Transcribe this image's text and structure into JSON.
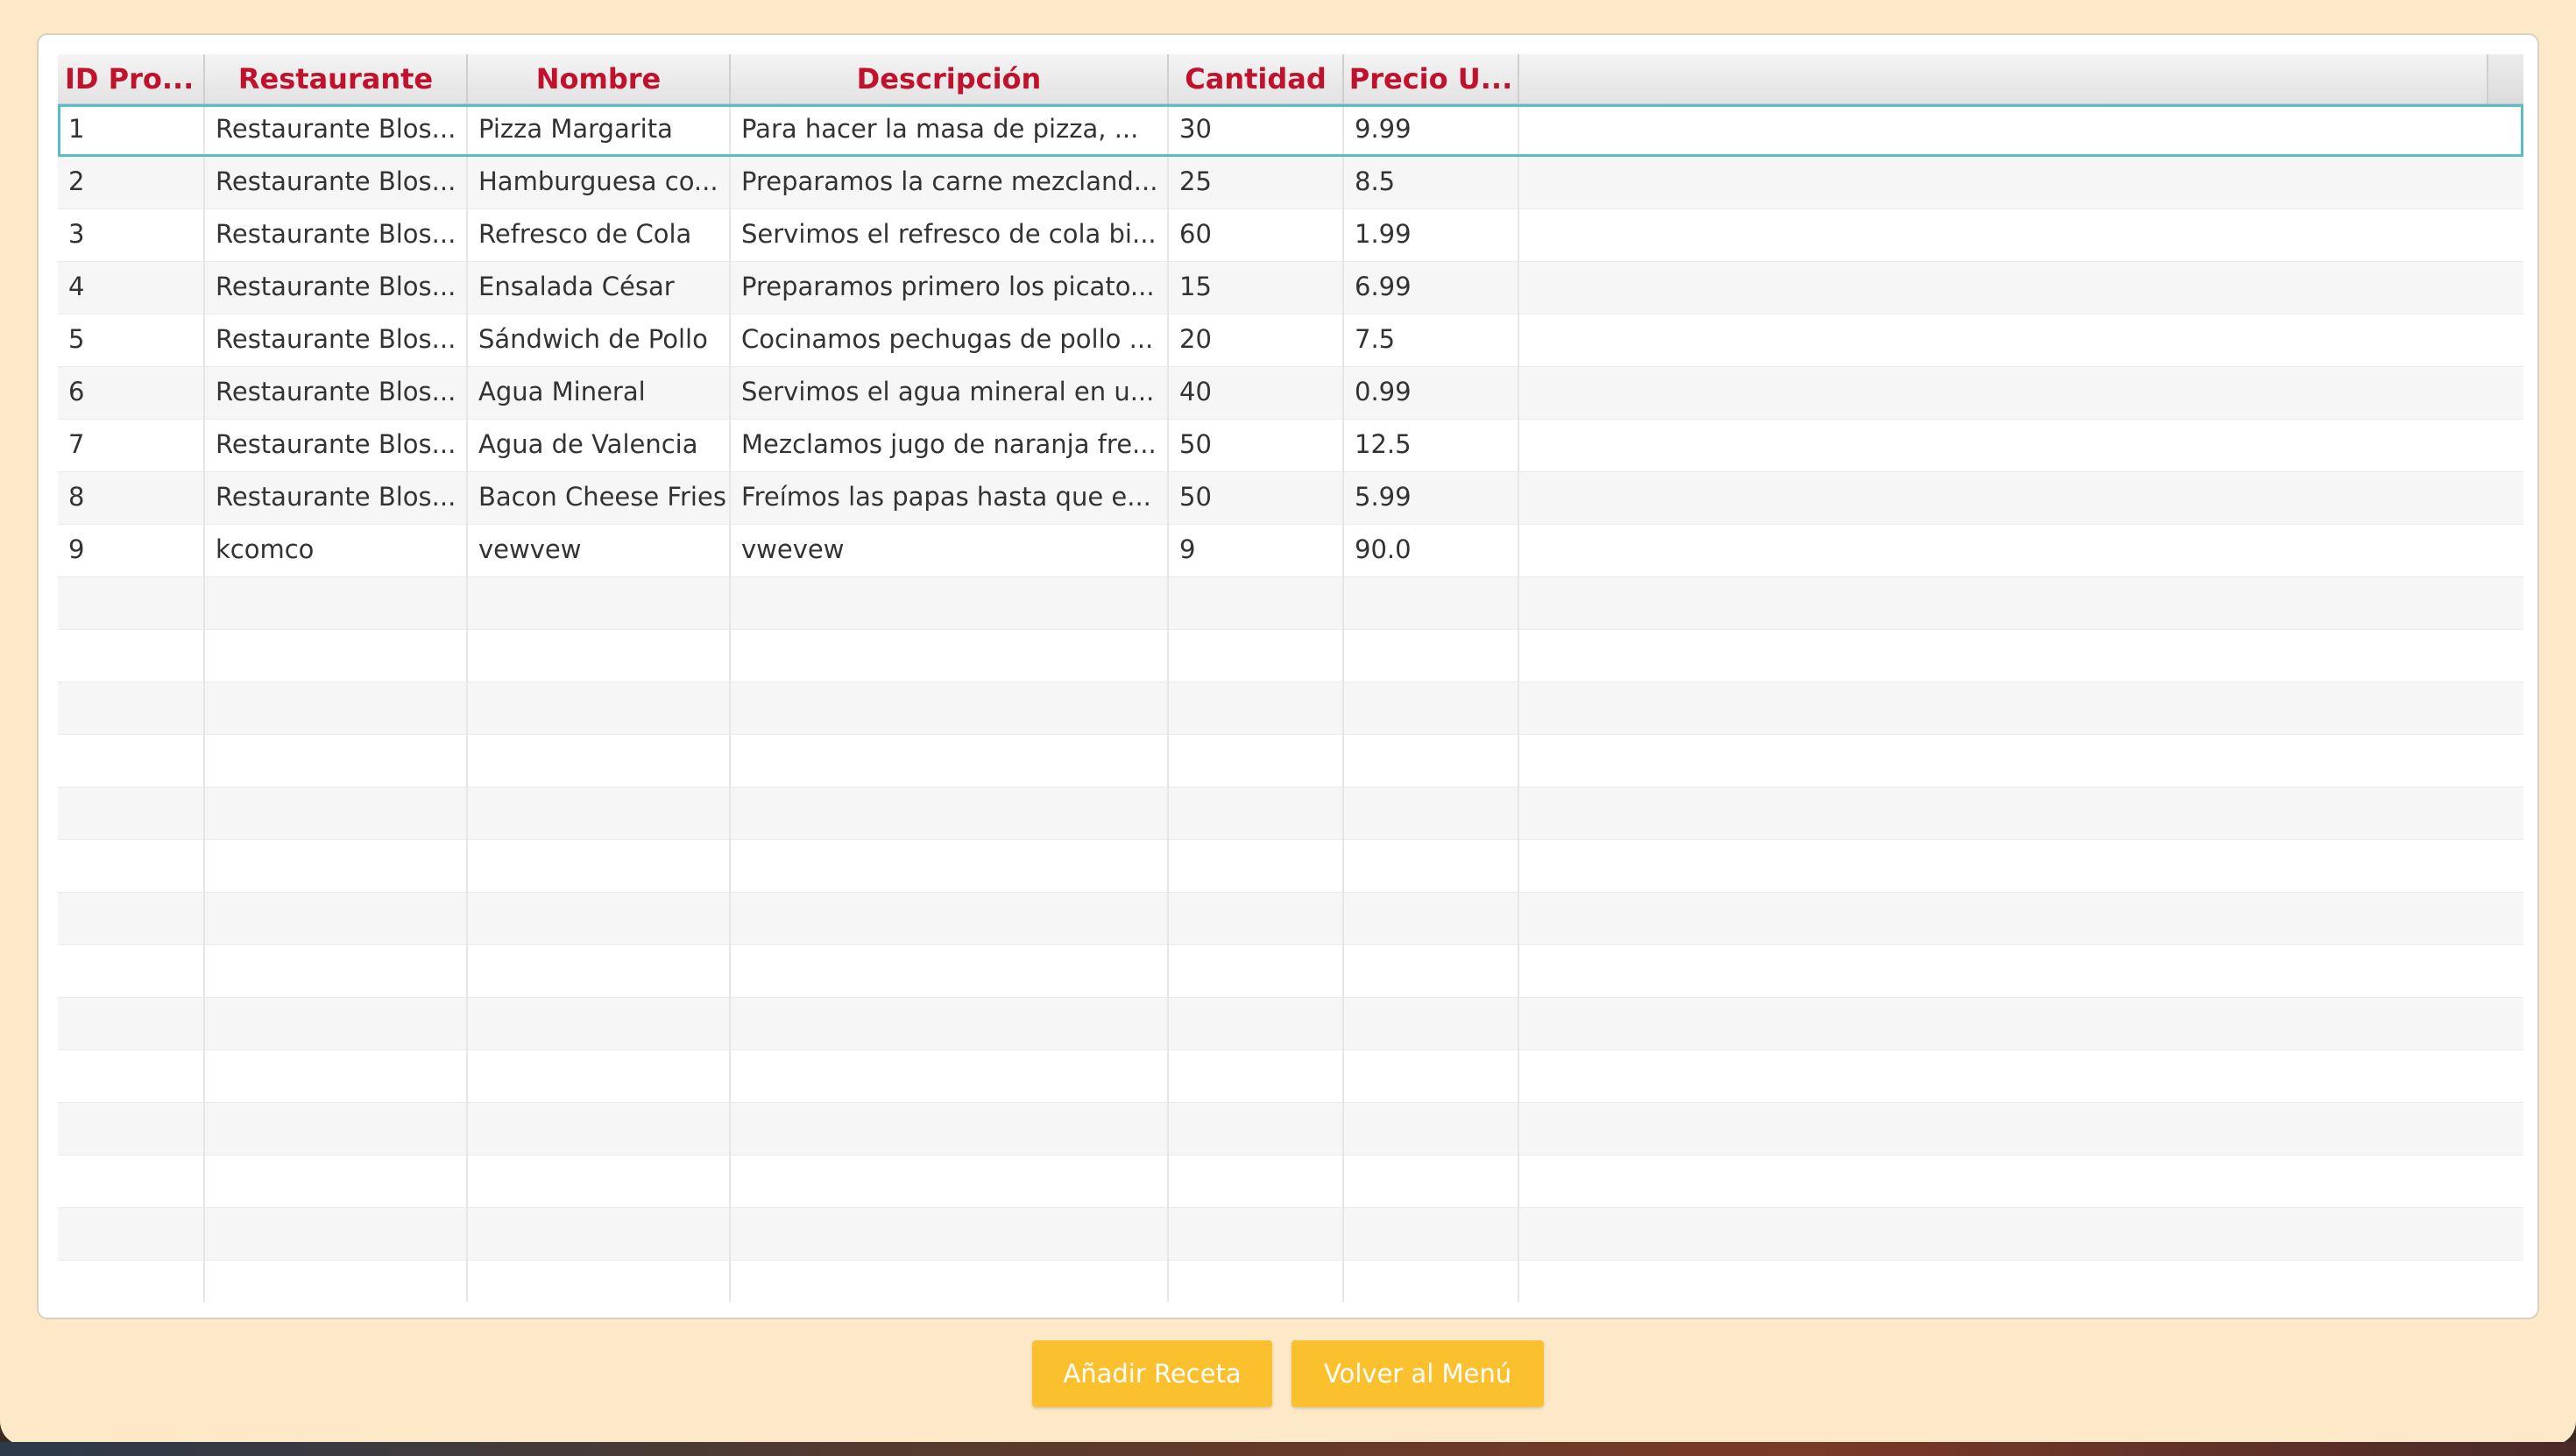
{
  "table": {
    "columns": [
      "ID Pro...",
      "Restaurante",
      "Nombre",
      "Descripción",
      "Cantidad",
      "Precio U..."
    ],
    "rows": [
      [
        "1",
        "Restaurante Blos...",
        "Pizza Margarita",
        "Para hacer la masa de pizza, ...",
        "30",
        "9.99"
      ],
      [
        "2",
        "Restaurante Blos...",
        "Hamburguesa co...",
        "Preparamos la carne mezcland...",
        "25",
        "8.5"
      ],
      [
        "3",
        "Restaurante Blos...",
        "Refresco de Cola",
        "Servimos el refresco de cola bi...",
        "60",
        "1.99"
      ],
      [
        "4",
        "Restaurante Blos...",
        "Ensalada César",
        "Preparamos primero los picato...",
        "15",
        "6.99"
      ],
      [
        "5",
        "Restaurante Blos...",
        "Sándwich de Pollo",
        "Cocinamos pechugas de pollo ...",
        "20",
        "7.5"
      ],
      [
        "6",
        "Restaurante Blos...",
        "Agua Mineral",
        "Servimos el agua mineral en u...",
        "40",
        "0.99"
      ],
      [
        "7",
        "Restaurante Blos...",
        "Agua de Valencia",
        "Mezclamos jugo de naranja fre...",
        "50",
        "12.5"
      ],
      [
        "8",
        "Restaurante Blos...",
        "Bacon Cheese Fries",
        "Freímos las papas hasta que e...",
        "50",
        "5.99"
      ],
      [
        "9",
        "kcomco",
        "vewvew",
        "vwevew",
        "9",
        "90.0"
      ]
    ],
    "selected_row": 0,
    "empty_rows": 14
  },
  "buttons": {
    "add_label": "Añadir Receta",
    "back_label": "Volver al Menú"
  },
  "colors": {
    "window_bg": "#fde9c7",
    "header_text": "#c0122c",
    "button_bg": "#fbc02d",
    "selection_border": "#5cbcc4"
  }
}
